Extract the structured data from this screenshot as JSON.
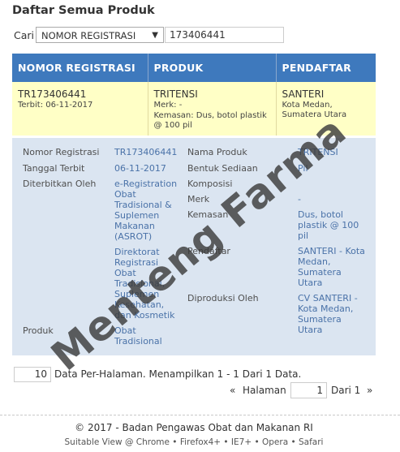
{
  "page": {
    "title": "Daftar Semua Produk"
  },
  "search": {
    "label": "Cari",
    "selected": "NOMOR REGISTRASI",
    "value": "173406441"
  },
  "table": {
    "headers": [
      "NOMOR REGISTRASI",
      "PRODUK",
      "PENDAFTAR"
    ],
    "row": {
      "nomor": "TR173406441",
      "terbit": "Terbit: 06-11-2017",
      "produk": "TRITENSI",
      "merk": "Merk: -",
      "kemasan": "Kemasan: Dus, botol plastik @ 100 pil",
      "pendaftar": "SANTERI",
      "lokasi": "Kota Medan, Sumatera Utara"
    }
  },
  "detail": {
    "left": [
      {
        "label": "Nomor Registrasi",
        "value": "TR173406441"
      },
      {
        "label": "Tanggal Terbit",
        "value": "06-11-2017"
      },
      {
        "label": "Diterbitkan Oleh",
        "value": "e-Registration Obat Tradisional & Suplemen Makanan (ASROT)",
        "value2": "Direktorat Registrasi Obat Tradisional, Suplemen Kesehatan, dan Kosmetik"
      },
      {
        "label": "Produk",
        "value": "Obat Tradisional"
      }
    ],
    "right": [
      {
        "label": "Nama Produk",
        "value": "TRITENSI"
      },
      {
        "label": "Bentuk Sediaan",
        "value": "Pil"
      },
      {
        "label": "Komposisi",
        "value": ""
      },
      {
        "label": "Merk",
        "value": "-"
      },
      {
        "label": "Kemasan",
        "value": "Dus, botol plastik @ 100 pil"
      },
      {
        "label": "Pendaftar",
        "value": "SANTERI - Kota Medan, Sumatera Utara"
      },
      {
        "label": "Diproduksi Oleh",
        "value": "CV SANTERI - Kota Medan, Sumatera Utara"
      }
    ]
  },
  "pager": {
    "per_page": "10",
    "per_page_text": "Data Per-Halaman. Menampilkan 1 - 1 Dari 1 Data.",
    "prev": "«",
    "halaman": "Halaman",
    "page": "1",
    "of": "Dari 1",
    "next": "»"
  },
  "footer": {
    "copyright": "© 2017 - Badan Pengawas Obat dan Makanan RI",
    "suitable": "Suitable View @ Chrome • Firefox4+ • IE7+ • Opera • Safari"
  },
  "watermark": "Menteng Farma",
  "colors": {
    "header_bg": "#3e79bd",
    "row_bg": "#ffffc6",
    "detail_bg": "#dbe5f1",
    "link": "#4a72a8"
  }
}
